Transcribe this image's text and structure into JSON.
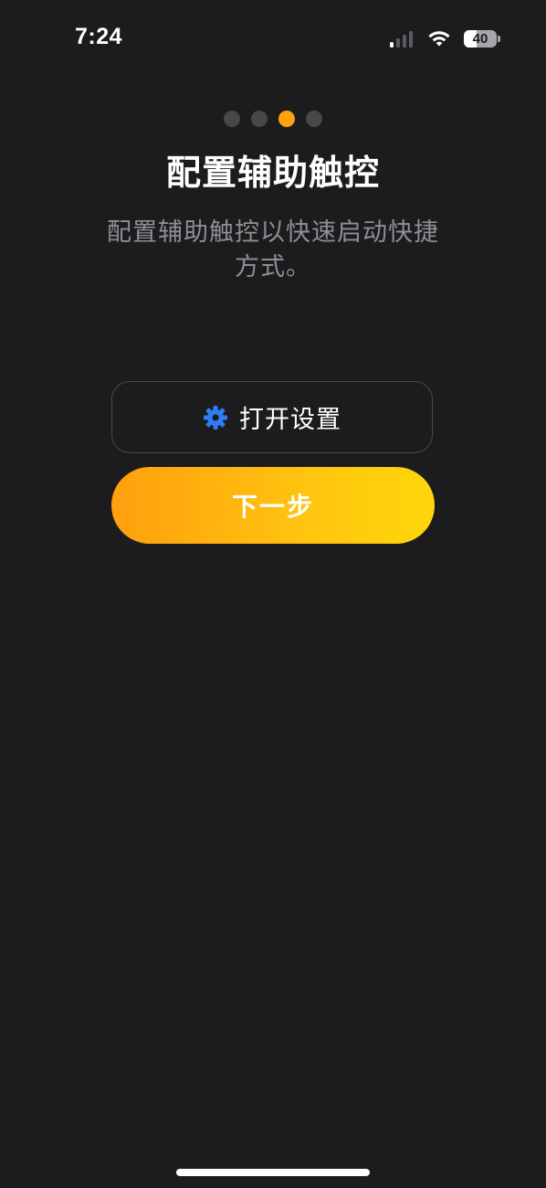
{
  "status_bar": {
    "time": "7:24",
    "battery_level": "40",
    "signal_bars_active": 1,
    "signal_bars_total": 4
  },
  "onboarding": {
    "page_count": 4,
    "current_page": 3,
    "title": "配置辅助触控",
    "description": "配置辅助触控以快速启动快捷方式。"
  },
  "buttons": {
    "open_settings": {
      "icon": "gear-icon",
      "label": "打开设置"
    },
    "next": {
      "label": "下一步"
    }
  },
  "colors": {
    "background": "#1c1c1e",
    "accent": "#ffa20f",
    "gear_icon": "#2f7cf6"
  }
}
